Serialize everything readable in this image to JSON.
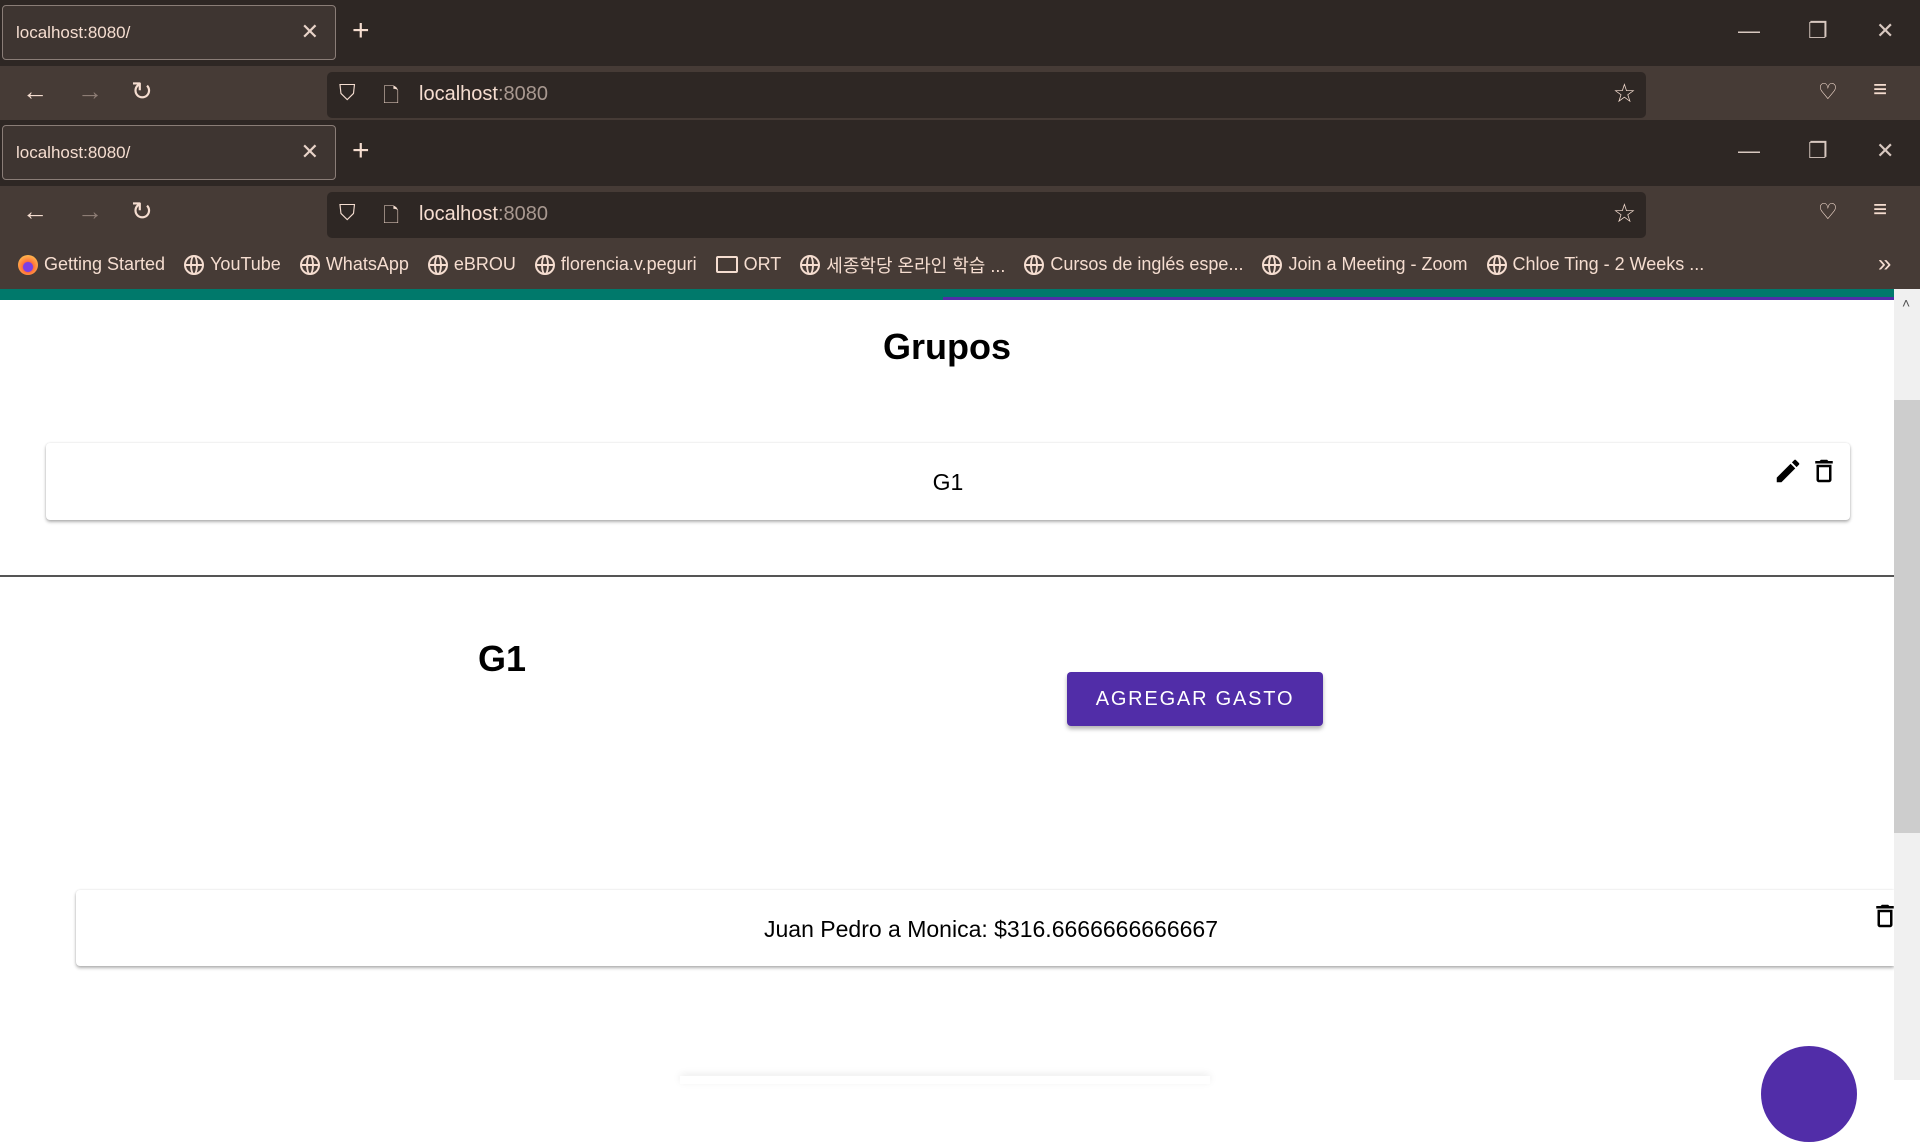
{
  "browser": {
    "tab_title": "localhost:8080/",
    "url_host": "localhost",
    "url_port": ":8080",
    "bookmarks": [
      "Getting Started",
      "YouTube",
      "WhatsApp",
      "eBROU",
      "florencia.v.peguri",
      "ORT",
      "세종학당 온라인 학습 ...",
      "Cursos de inglés espe...",
      "Join a Meeting - Zoom",
      "Chloe Ting - 2 Weeks ..."
    ]
  },
  "page": {
    "title": "Grupos",
    "groups": [
      {
        "name": "G1"
      }
    ],
    "selected_group": {
      "name": "G1",
      "add_expense_label": "AGREGAR GASTO"
    },
    "debts": [
      {
        "text": "Juan Pedro a Monica: $316.6666666666667"
      }
    ]
  },
  "colors": {
    "accent": "#512da8",
    "teal": "#00796b"
  }
}
